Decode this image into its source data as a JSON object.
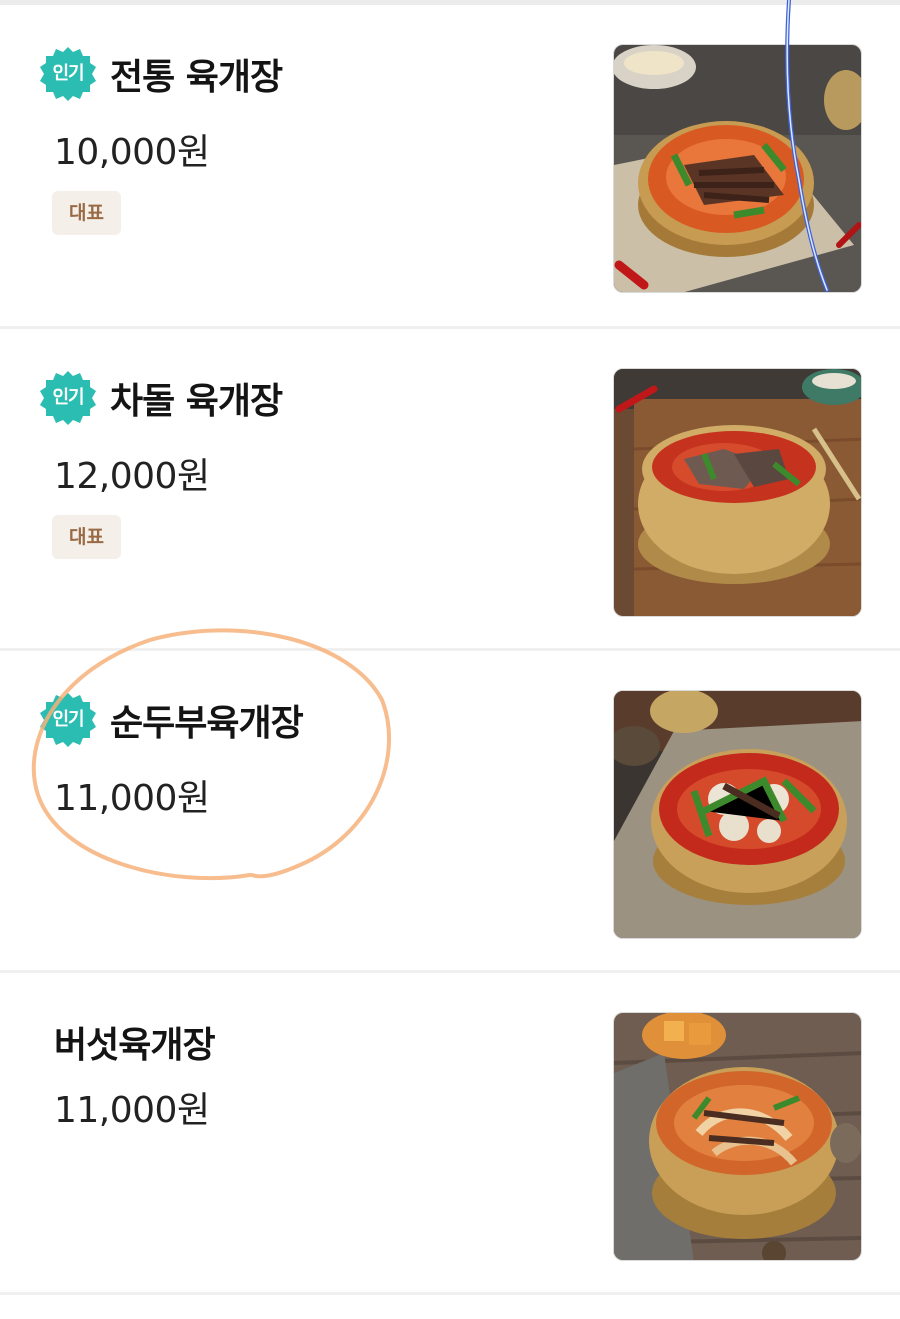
{
  "badge_popular_label": "인기",
  "signature_label": "대표",
  "menu_items": [
    {
      "name": "전통 육개장",
      "price": "10,000원",
      "popular": true,
      "signature": true,
      "photo_icon": "yukgaejang-bowl-photo"
    },
    {
      "name": "차돌 육개장",
      "price": "12,000원",
      "popular": true,
      "signature": true,
      "photo_icon": "chadol-yukgaejang-bowl-photo"
    },
    {
      "name": "순두부육개장",
      "price": "11,000원",
      "popular": true,
      "signature": false,
      "photo_icon": "sundubu-yukgaejang-bowl-photo"
    },
    {
      "name": "버섯육개장",
      "price": "11,000원",
      "popular": false,
      "signature": false,
      "photo_icon": "mushroom-yukgaejang-bowl-photo"
    }
  ],
  "colors": {
    "popular_badge": "#2bbdb1",
    "signature_tag_bg": "#f4efe9",
    "signature_tag_text": "#9a6a45",
    "annotation_circle": "#f6b27a",
    "annotation_line": "#3e63d8"
  }
}
